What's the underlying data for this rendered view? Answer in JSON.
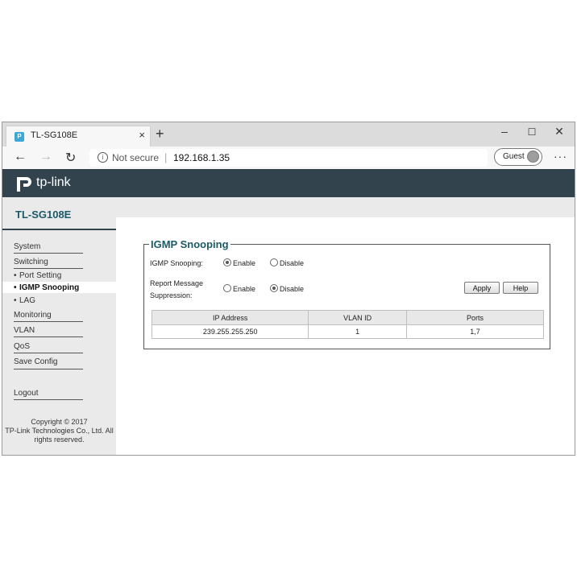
{
  "browser": {
    "tab_title": "TL-SG108E",
    "tab_close": "×",
    "new_tab": "+",
    "window_controls": {
      "minimize": "–",
      "maximize": "☐",
      "close": "✕"
    },
    "nav": {
      "back": "←",
      "forward": "→",
      "reload": "↻"
    },
    "security_label": "Not secure",
    "url": "192.168.1.35",
    "profile_label": "Guest",
    "more_menu": "···"
  },
  "header": {
    "logo_text": "tp-link",
    "model": "TL-SG108E"
  },
  "sidebar": {
    "items": {
      "system": "System",
      "switching": "Switching",
      "port_setting": "Port Setting",
      "igmp_snooping": "IGMP Snooping",
      "lag": "LAG",
      "monitoring": "Monitoring",
      "vlan": "VLAN",
      "qos": "QoS",
      "save_config": "Save Config",
      "logout": "Logout"
    },
    "bullet": "•",
    "copyright_line1": "Copyright © 2017",
    "copyright_line2": "TP-Link Technologies Co., Ltd. All",
    "copyright_line3": "rights reserved."
  },
  "main": {
    "section_title": "IGMP Snooping",
    "igmp_label": "IGMP Snooping:",
    "igmp_enable": "Enable",
    "igmp_disable": "Disable",
    "igmp_selected": "Enable",
    "suppression_label_line1": "Report Message",
    "suppression_label_line2": "Suppression:",
    "suppression_enable": "Enable",
    "suppression_disable": "Disable",
    "suppression_selected": "Disable",
    "apply_button": "Apply",
    "help_button": "Help",
    "table": {
      "headers": [
        "IP Address",
        "VLAN ID",
        "Ports"
      ],
      "rows": [
        [
          "239.255.255.250",
          "1",
          "1,7"
        ]
      ]
    }
  },
  "colors": {
    "header_bg": "#33434e",
    "accent_text": "#1c5a68",
    "sidebar_bg": "#eaeaea"
  }
}
